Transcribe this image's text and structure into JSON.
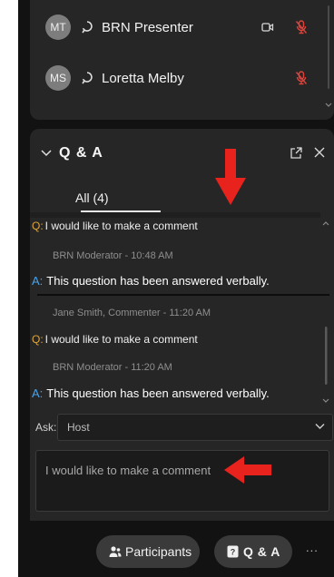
{
  "participants": [
    {
      "initials": "MT",
      "name": "BRN Presenter",
      "has_video": true,
      "muted": true
    },
    {
      "initials": "MS",
      "name": "Loretta Melby",
      "has_video": false,
      "muted": true
    }
  ],
  "qa": {
    "title": "Q & A",
    "tab_all": "All (4)",
    "q_prefix": "Q:",
    "a_prefix": "A:",
    "items": [
      {
        "question": "I would like to make a comment"
      },
      {
        "meta": "BRN Moderator - 10:48 AM",
        "answer": "This question has been answered verbally."
      },
      {
        "meta": "Jane Smith, Commenter  - 11:20 AM",
        "question": "I would like to make a comment"
      },
      {
        "meta": "BRN Moderator - 11:20 AM",
        "answer": "This question has been answered verbally."
      }
    ],
    "ask_label": "Ask:",
    "ask_value": "Host",
    "comment_text": "I would like to make a comment"
  },
  "bottom_bar": {
    "participants_label": "Participants",
    "qa_label": "Q & A",
    "more_label": "..."
  },
  "colors": {
    "question_prefix": "#e0a53a",
    "answer_prefix": "#4aa3e8",
    "mute_red": "#e0423a",
    "annotation_red": "#e8231e"
  }
}
